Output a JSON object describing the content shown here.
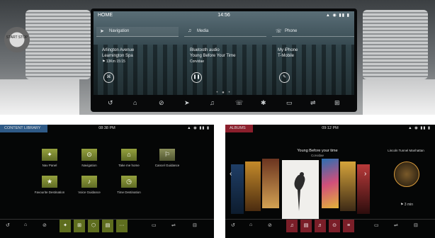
{
  "top": {
    "knob_label": "START STOP",
    "status": {
      "left": "HOME",
      "time": "14:56",
      "icons": "▲ ◉ ▮▮ ▮"
    },
    "tiles": [
      {
        "icon": "➤",
        "title": "Navigation",
        "line1": "Arlington Avenue",
        "line2": "Leamington Spa",
        "line3": "⚑ 13Km 15:15",
        "button": "⌘"
      },
      {
        "icon": "♫",
        "title": "Media",
        "line1": "Bluetooth audio",
        "line2": "Young Before Your Time",
        "line3": "Corvidae",
        "button": "❚❚"
      },
      {
        "icon": "☏",
        "title": "Phone",
        "line1": "My iPhone",
        "line2": "T-Mobile",
        "line3": "",
        "button": "✎"
      }
    ],
    "page_dots": "• ● •",
    "dock": [
      "↺",
      "⌂",
      "⊘",
      "➤",
      "♫",
      "☏",
      "✱",
      "▭",
      "⇌",
      "⊞"
    ]
  },
  "library": {
    "status": {
      "left": "CONTENT LIBRARY",
      "time": "08:38 PM",
      "icons": "▲ ◉ ▮▮ ▮"
    },
    "items": [
      {
        "icon": "✦",
        "label": "Nav Panel"
      },
      {
        "icon": "⊙",
        "label": "Navigation"
      },
      {
        "icon": "⌂",
        "label": "Take me home"
      },
      {
        "icon": "⚐",
        "label": "Cancel Guidance"
      },
      {
        "icon": "★",
        "label": "Favourite Destination"
      },
      {
        "icon": "♪",
        "label": "Voice Guidance"
      },
      {
        "icon": "◷",
        "label": "Time Destination"
      }
    ],
    "dock": [
      "↺",
      "⌂",
      "⊘",
      "✦",
      "⊞",
      "⬡",
      "▤",
      "···",
      "▭",
      "⇌",
      "⊟"
    ]
  },
  "albums": {
    "status": {
      "left": "ALBUMS",
      "time": "09:12 PM",
      "icons": "▲ ◉ ▮▮ ▮"
    },
    "title": "Young Before your time",
    "artist": "Corvidae",
    "side_title": "Lincoln Tunnel Manhattan",
    "side_meta": "⚑ 3 min",
    "dock": [
      "↺",
      "⌂",
      "⊘",
      "♫",
      "▤",
      "♬",
      "⊙",
      "≡",
      "▭",
      "⇌",
      "⊟"
    ]
  }
}
